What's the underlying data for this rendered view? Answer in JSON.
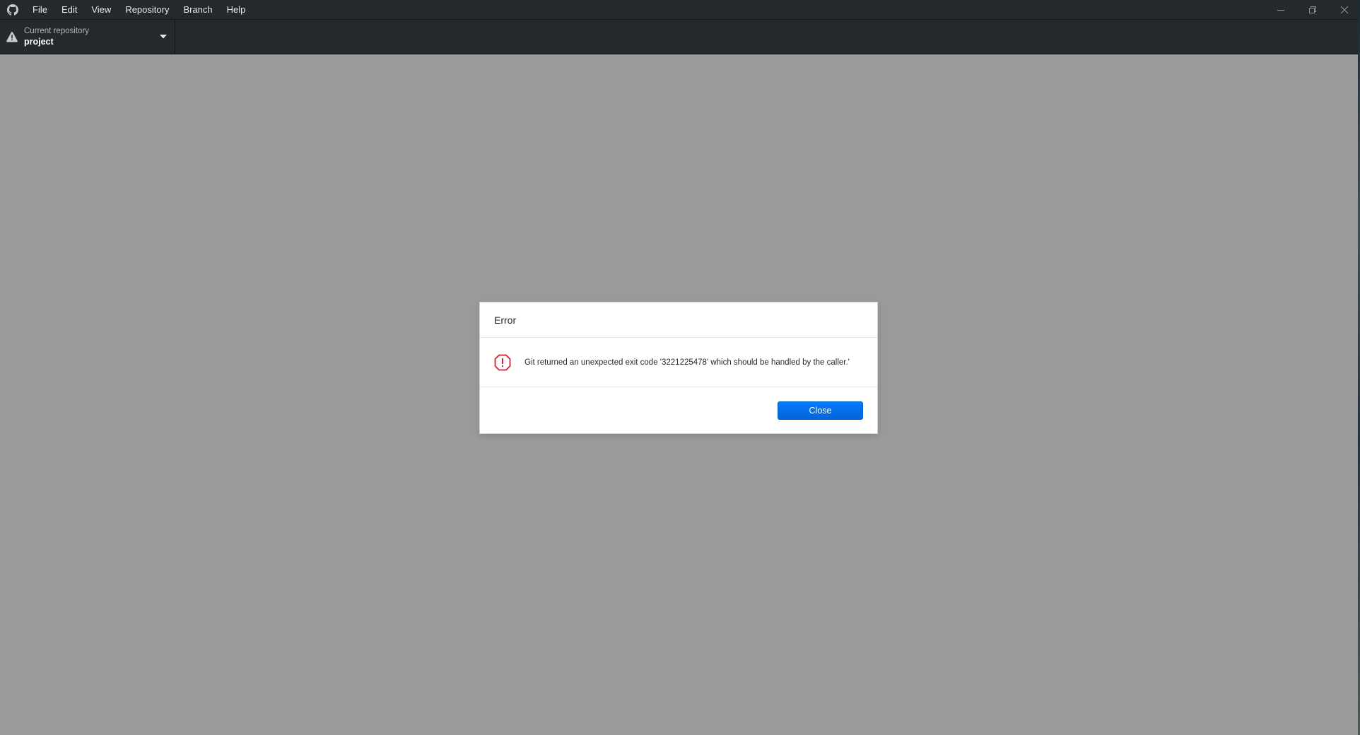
{
  "app": {
    "logo_icon": "github-octocat-icon"
  },
  "menu": {
    "items": [
      {
        "label": "File"
      },
      {
        "label": "Edit"
      },
      {
        "label": "View"
      },
      {
        "label": "Repository"
      },
      {
        "label": "Branch"
      },
      {
        "label": "Help"
      }
    ]
  },
  "window_controls": {
    "icons": [
      "minimize-icon",
      "restore-icon",
      "close-icon"
    ]
  },
  "toolbar": {
    "repository": {
      "caption": "Current repository",
      "name": "project",
      "status_icon": "warning-icon"
    }
  },
  "dialog": {
    "title": "Error",
    "message": "Git returned an unexpected exit code '3221225478' which should be handled by the caller.'",
    "icon": "error-icon",
    "close_label": "Close"
  },
  "colors": {
    "accent": "#0366d6",
    "error": "#cb2431",
    "chrome": "#24292e",
    "overlay": "#9a9a9a"
  }
}
